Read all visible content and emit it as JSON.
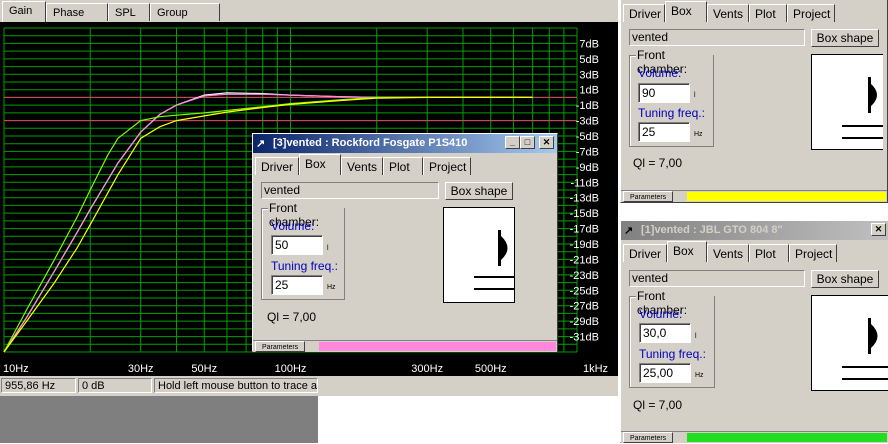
{
  "main": {
    "tabs": [
      "Gain",
      "Phase plot",
      "SPL",
      "Group delay"
    ],
    "active_tab": "Gain"
  },
  "chart_data": {
    "type": "line",
    "x_scale": "log",
    "xlim": [
      10,
      1000
    ],
    "ylim": [
      -33,
      9
    ],
    "x_tick_labels": [
      {
        "v": 10,
        "t": "10Hz"
      },
      {
        "v": 30,
        "t": "30Hz"
      },
      {
        "v": 50,
        "t": "50Hz"
      },
      {
        "v": 100,
        "t": "100Hz"
      },
      {
        "v": 300,
        "t": "300Hz"
      },
      {
        "v": 500,
        "t": "500Hz"
      },
      {
        "v": 1000,
        "t": "1kHz"
      }
    ],
    "y_tick_labels": [
      {
        "v": 7,
        "t": "7dB"
      },
      {
        "v": 5,
        "t": "5dB"
      },
      {
        "v": 3,
        "t": "3dB"
      },
      {
        "v": 1,
        "t": "1dB"
      },
      {
        "v": -1,
        "t": "-1dB"
      },
      {
        "v": -3,
        "t": "-3dB"
      },
      {
        "v": -5,
        "t": "-5dB"
      },
      {
        "v": -7,
        "t": "-7dB"
      },
      {
        "v": -9,
        "t": "-9dB"
      },
      {
        "v": -11,
        "t": "-11dB"
      },
      {
        "v": -13,
        "t": "-13dB"
      },
      {
        "v": -15,
        "t": "-15dB"
      },
      {
        "v": -17,
        "t": "-17dB"
      },
      {
        "v": -19,
        "t": "-19dB"
      },
      {
        "v": -21,
        "t": "-21dB"
      },
      {
        "v": -23,
        "t": "-23dB"
      },
      {
        "v": -25,
        "t": "-25dB"
      },
      {
        "v": -27,
        "t": "-27dB"
      },
      {
        "v": -29,
        "t": "-29dB"
      },
      {
        "v": -31,
        "t": "-31dB"
      }
    ],
    "reference_lines": [
      {
        "y": 0,
        "color": "#e0406a"
      },
      {
        "y": -3,
        "color": "#e0406a"
      }
    ],
    "series": [
      {
        "color": "#ffffff",
        "x": [
          10,
          12,
          15,
          18,
          20,
          25,
          30,
          35,
          40,
          50,
          60,
          80,
          100,
          150,
          200,
          300,
          500,
          700
        ],
        "y": [
          -33,
          -28.5,
          -22.5,
          -17.5,
          -14.5,
          -8.5,
          -4.5,
          -2.2,
          -1,
          0.3,
          0.6,
          0.5,
          0.3,
          0.1,
          0,
          0,
          0,
          0
        ]
      },
      {
        "color": "#ff88dd",
        "x": [
          10,
          12,
          15,
          18,
          20,
          25,
          30,
          35,
          40,
          50,
          60,
          80,
          100,
          150,
          200,
          300,
          500,
          700
        ],
        "y": [
          -33,
          -28.5,
          -22.5,
          -17.5,
          -14.5,
          -8.5,
          -4.5,
          -2.2,
          -1,
          0.2,
          0.4,
          0.4,
          0.3,
          0.1,
          0,
          0,
          0,
          0
        ]
      },
      {
        "color": "#7cfc00",
        "x": [
          10,
          12,
          15,
          18,
          20,
          23,
          25,
          30,
          35,
          40,
          50,
          60,
          80,
          100,
          150,
          200,
          300,
          500,
          700
        ],
        "y": [
          -33,
          -27.5,
          -21,
          -15.5,
          -12,
          -7.5,
          -5.3,
          -3,
          -2.5,
          -2.3,
          -2,
          -1.7,
          -1.2,
          -0.8,
          -0.3,
          0,
          0,
          0,
          0
        ]
      },
      {
        "color": "#ffff00",
        "x": [
          10,
          12,
          15,
          18,
          20,
          25,
          30,
          35,
          40,
          50,
          60,
          80,
          100,
          150,
          200,
          300,
          500,
          700
        ],
        "y": [
          -33,
          -29,
          -24,
          -19.5,
          -16.5,
          -10,
          -5.3,
          -3.8,
          -3,
          -2.4,
          -1.9,
          -1.3,
          -0.9,
          -0.4,
          -0.1,
          0,
          0,
          0
        ]
      }
    ]
  },
  "status": {
    "freq": "955,86 Hz",
    "gain": "0 dB",
    "hint": "Hold left mouse button to trace ac"
  },
  "windows": {
    "top_right": {
      "tabs": [
        "Driver",
        "Box",
        "Vents",
        "Plot",
        "Project"
      ],
      "active_tab": "Box",
      "box_type": "vented",
      "box_shape_label": "Box shape",
      "group_label": "Front chamber:",
      "volume_label": "Volume:",
      "volume_value": "90",
      "volume_unit": "l",
      "tuning_label": "Tuning freq.:",
      "tuning_value": "25",
      "tuning_unit": "Hz",
      "ql": "Ql = 7,00",
      "parameters_label": "Parameters",
      "parameters_color": "#ffff00"
    },
    "middle": {
      "title": "[3]vented : Rockford Fosgate P1S410",
      "tabs": [
        "Driver",
        "Box",
        "Vents",
        "Plot",
        "Project"
      ],
      "active_tab": "Box",
      "box_type": "vented",
      "box_shape_label": "Box shape",
      "group_label": "Front chamber:",
      "volume_label": "Volume:",
      "volume_value": "50",
      "volume_unit": "l",
      "tuning_label": "Tuning freq.:",
      "tuning_value": "25",
      "tuning_unit": "Hz",
      "ql": "Ql = 7,00",
      "parameters_label": "Parameters",
      "parameters_color": "#ff88dd"
    },
    "bottom_right": {
      "title": "[1]vented : JBL GTO 804 8\"",
      "tabs": [
        "Driver",
        "Box",
        "Vents",
        "Plot",
        "Project"
      ],
      "active_tab": "Box",
      "box_type": "vented",
      "box_shape_label": "Box shape",
      "group_label": "Front chamber:",
      "volume_label": "Volume:",
      "volume_value": "30,0",
      "volume_unit": "l",
      "tuning_label": "Tuning freq.:",
      "tuning_value": "25,00",
      "tuning_unit": "Hz",
      "ql": "Ql = 7,00",
      "parameters_label": "Parameters",
      "parameters_color": "#22dd22"
    }
  }
}
